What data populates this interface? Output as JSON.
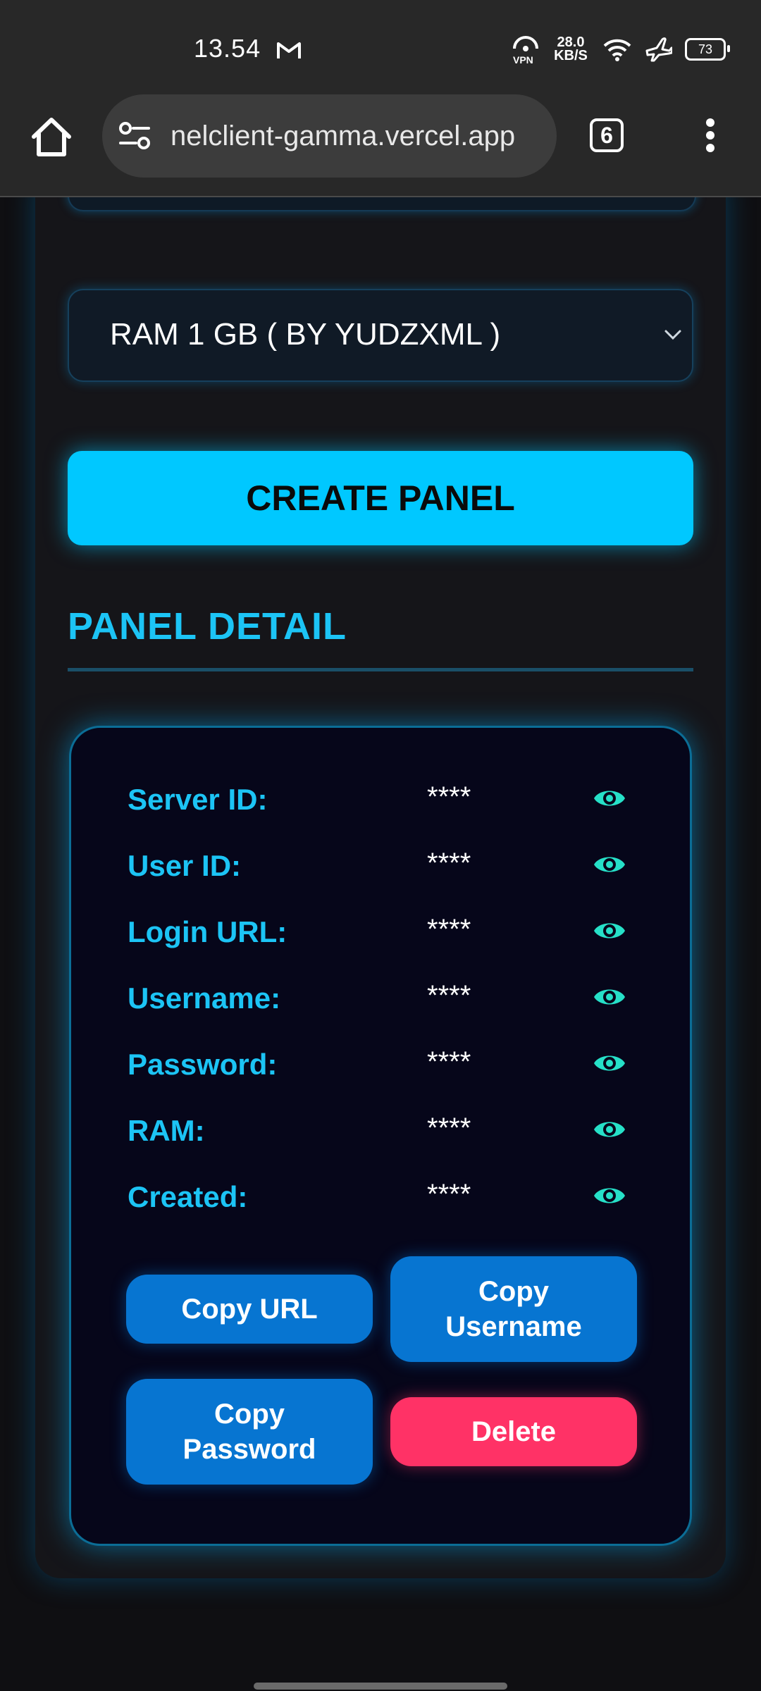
{
  "status_bar": {
    "time": "13.54",
    "mail_icon": "gmail-icon",
    "vpn_label": "VPN",
    "speed_value": "28.0",
    "speed_unit": "KB/S",
    "battery": "73"
  },
  "browser": {
    "url": "nelclient-gamma.vercel.app",
    "tab_count": "6"
  },
  "form": {
    "ram_select_value": "RAM 1 GB ( BY YUDZXML )",
    "create_button": "CREATE PANEL"
  },
  "panel_detail": {
    "title": "PANEL DETAIL",
    "rows": [
      {
        "label": "Server ID:",
        "value": "****"
      },
      {
        "label": "User ID:",
        "value": "****"
      },
      {
        "label": "Login URL:",
        "value": "****"
      },
      {
        "label": "Username:",
        "value": "****"
      },
      {
        "label": "Password:",
        "value": "****"
      },
      {
        "label": "RAM:",
        "value": "****"
      },
      {
        "label": "Created:",
        "value": "****"
      }
    ],
    "buttons": {
      "copy_url": "Copy URL",
      "copy_username_1": "Copy",
      "copy_username_2": "Username",
      "copy_password_1": "Copy",
      "copy_password_2": "Password",
      "delete": "Delete"
    }
  },
  "colors": {
    "accent": "#1cc4f5",
    "primary_button": "#00c8ff",
    "action_blue": "#0775d1",
    "danger": "#ff3266",
    "eye_icon": "#26e0c8"
  }
}
